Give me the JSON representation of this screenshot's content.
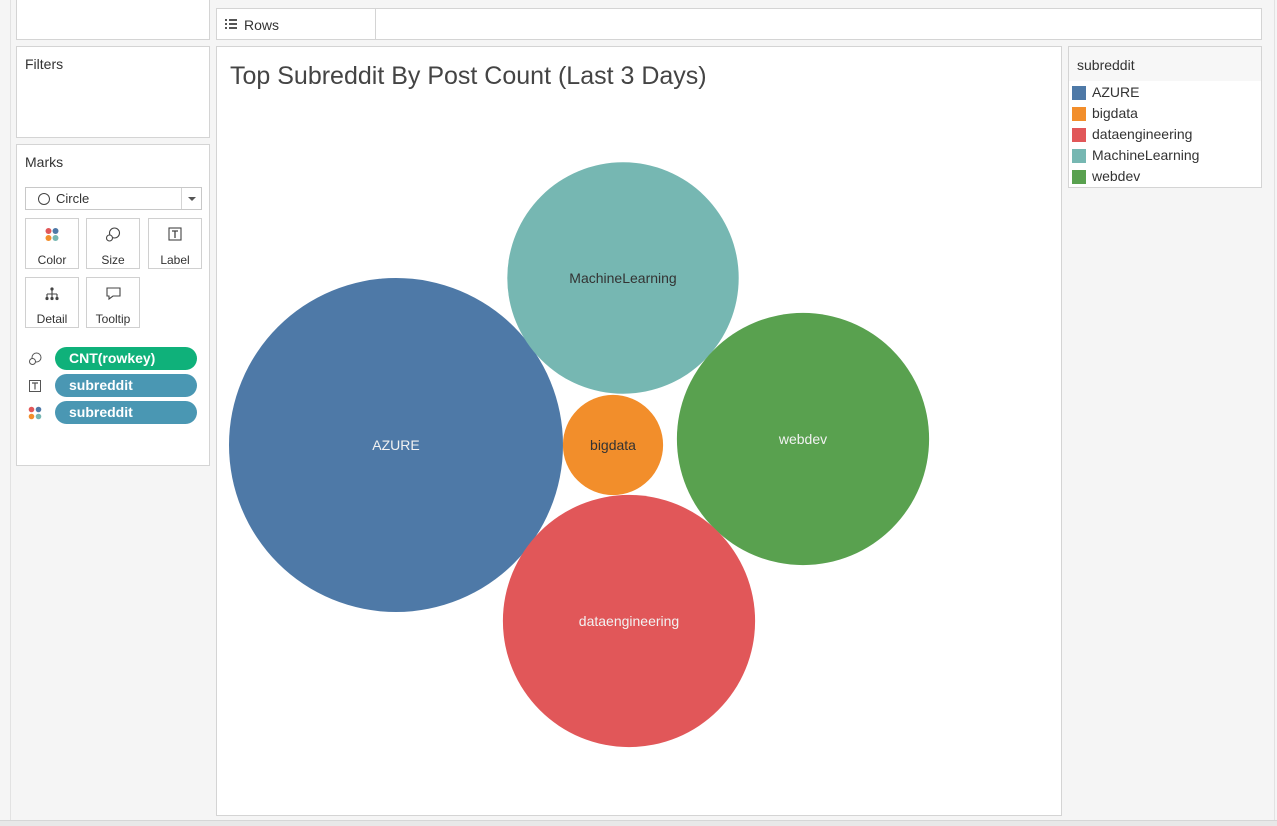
{
  "shelves": {
    "rows_label": "Rows"
  },
  "cards": {
    "filters_title": "Filters",
    "marks_title": "Marks",
    "mark_type": "Circle",
    "buttons": [
      {
        "label": "Color",
        "icon": "color-dots-icon"
      },
      {
        "label": "Size",
        "icon": "size-circles-icon"
      },
      {
        "label": "Label",
        "icon": "label-text-icon"
      },
      {
        "label": "Detail",
        "icon": "detail-hierarchy-icon"
      },
      {
        "label": "Tooltip",
        "icon": "tooltip-bubble-icon"
      }
    ],
    "pills": [
      {
        "label": "CNT(rowkey)",
        "icon": "size-circles-icon",
        "color": "#0fb17a"
      },
      {
        "label": "subreddit",
        "icon": "label-text-icon",
        "color": "#4a97b3"
      },
      {
        "label": "subreddit",
        "icon": "color-dots-icon",
        "color": "#4a97b3"
      }
    ]
  },
  "chart_data": {
    "type": "bubble",
    "title": "Top Subreddit By Post Count (Last 3 Days)",
    "size_measure": "CNT(rowkey)",
    "series": [
      {
        "name": "AZURE",
        "value": 100,
        "color": "#4e79a7"
      },
      {
        "name": "MachineLearning",
        "value": 48,
        "color": "#76b7b2"
      },
      {
        "name": "webdev",
        "value": 57,
        "color": "#59a14f"
      },
      {
        "name": "dataengineering",
        "value": 57,
        "color": "#e15759"
      },
      {
        "name": "bigdata",
        "value": 9,
        "color": "#f28e2b"
      }
    ]
  },
  "legend": {
    "title": "subreddit",
    "items": [
      {
        "label": "AZURE",
        "color": "#4e79a7"
      },
      {
        "label": "bigdata",
        "color": "#f28e2b"
      },
      {
        "label": "dataengineering",
        "color": "#e15759"
      },
      {
        "label": "MachineLearning",
        "color": "#76b7b2"
      },
      {
        "label": "webdev",
        "color": "#59a14f"
      }
    ]
  }
}
